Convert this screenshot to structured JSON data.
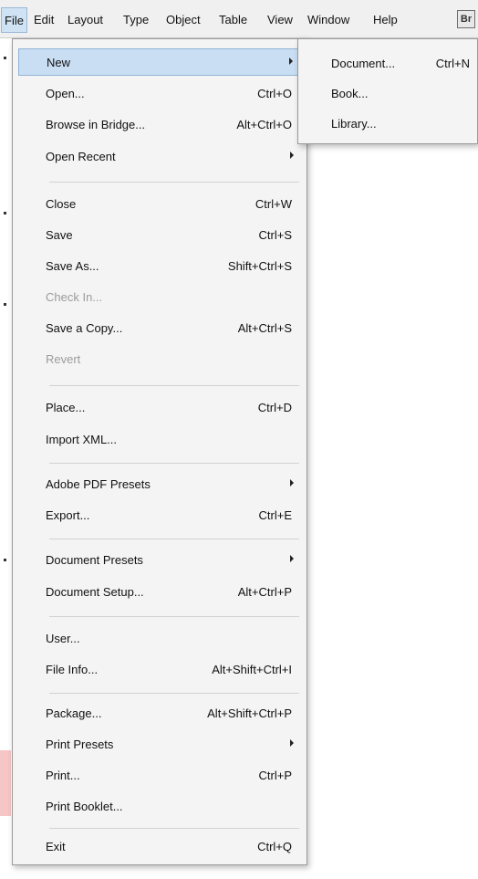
{
  "menubar": {
    "items": [
      "File",
      "Edit",
      "Layout",
      "Type",
      "Object",
      "Table",
      "View",
      "Window",
      "Help"
    ],
    "br_icon": "Br"
  },
  "file_menu": {
    "items": [
      {
        "label": "New",
        "shortcut": "",
        "submenu": true,
        "highlighted": true
      },
      {
        "label": "Open...",
        "shortcut": "Ctrl+O"
      },
      {
        "label": "Browse in Bridge...",
        "shortcut": "Alt+Ctrl+O"
      },
      {
        "label": "Open Recent",
        "shortcut": "",
        "submenu": true
      },
      {
        "label": "Close",
        "shortcut": "Ctrl+W"
      },
      {
        "label": "Save",
        "shortcut": "Ctrl+S"
      },
      {
        "label": "Save As...",
        "shortcut": "Shift+Ctrl+S"
      },
      {
        "label": "Check In...",
        "shortcut": "",
        "disabled": true
      },
      {
        "label": "Save a Copy...",
        "shortcut": "Alt+Ctrl+S"
      },
      {
        "label": "Revert",
        "shortcut": "",
        "disabled": true
      },
      {
        "label": "Place...",
        "shortcut": "Ctrl+D"
      },
      {
        "label": "Import XML...",
        "shortcut": ""
      },
      {
        "label": "Adobe PDF Presets",
        "shortcut": "",
        "submenu": true
      },
      {
        "label": "Export...",
        "shortcut": "Ctrl+E"
      },
      {
        "label": "Document Presets",
        "shortcut": "",
        "submenu": true
      },
      {
        "label": "Document Setup...",
        "shortcut": "Alt+Ctrl+P"
      },
      {
        "label": "User...",
        "shortcut": ""
      },
      {
        "label": "File Info...",
        "shortcut": "Alt+Shift+Ctrl+I"
      },
      {
        "label": "Package...",
        "shortcut": "Alt+Shift+Ctrl+P"
      },
      {
        "label": "Print Presets",
        "shortcut": "",
        "submenu": true
      },
      {
        "label": "Print...",
        "shortcut": "Ctrl+P"
      },
      {
        "label": "Print Booklet...",
        "shortcut": ""
      },
      {
        "label": "Exit",
        "shortcut": "Ctrl+Q"
      }
    ]
  },
  "new_submenu": {
    "items": [
      {
        "label": "Document...",
        "shortcut": "Ctrl+N"
      },
      {
        "label": "Book...",
        "shortcut": ""
      },
      {
        "label": "Library...",
        "shortcut": ""
      }
    ]
  },
  "colors": {
    "highlight": "#c9def2",
    "disabled": "#9c9c9c",
    "menu_bg": "#f4f4f4"
  }
}
